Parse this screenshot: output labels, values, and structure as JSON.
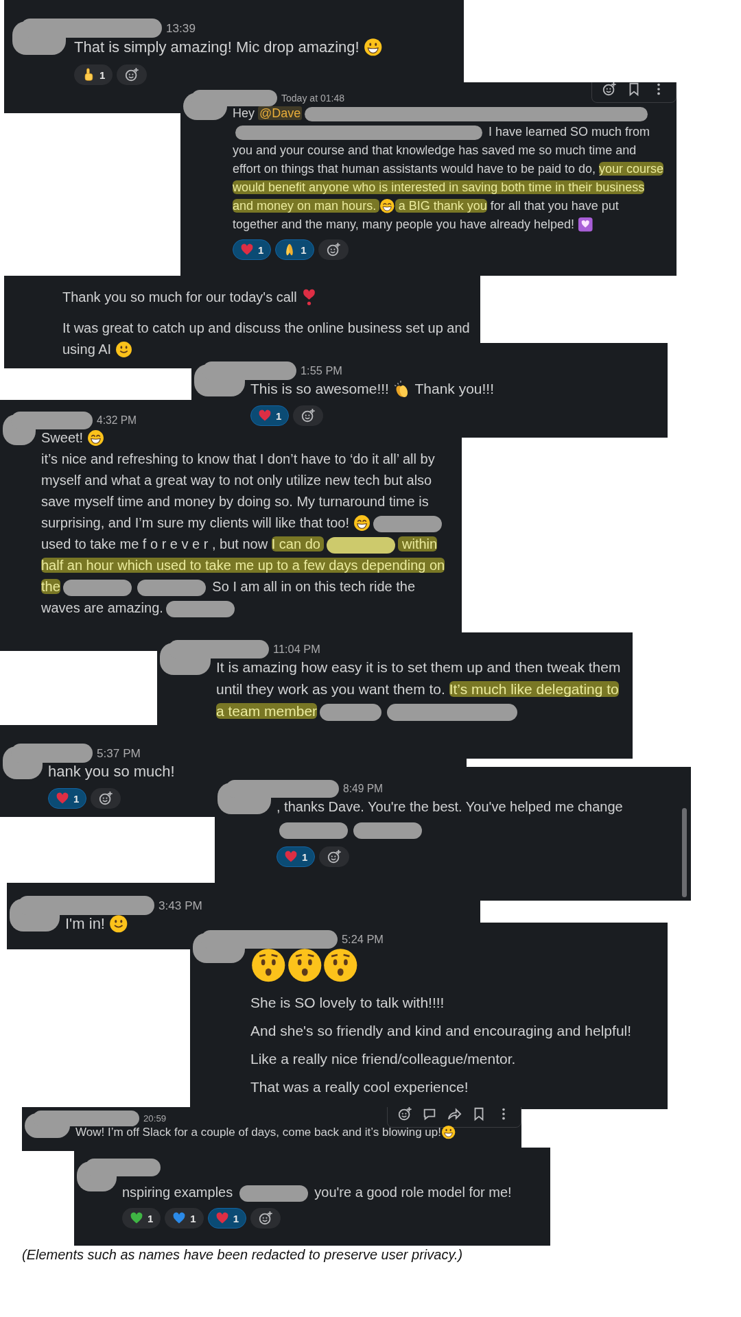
{
  "cards": [
    {
      "sender": {
        "kind": "redacted"
      },
      "time": "13:39",
      "paragraphs": [
        [
          {
            "kind": "text",
            "text": "That is simply amazing! Mic drop amazing! "
          },
          {
            "kind": "grin"
          }
        ]
      ],
      "reactions": [
        {
          "kind": "point-up",
          "count": "1",
          "selected": false
        }
      ]
    },
    {
      "sender": {
        "kind": "redacted"
      },
      "time": "Today at 01:48",
      "toolbar": [
        {
          "kind": "add-reaction"
        },
        {
          "kind": "bookmark"
        },
        {
          "kind": "more"
        }
      ],
      "paragraphs": [
        [
          {
            "kind": "text",
            "text": "Hey "
          },
          {
            "kind": "mention",
            "text": "@Dave"
          },
          {
            "kind": "redacted"
          },
          {
            "kind": "redacted"
          },
          {
            "kind": "text",
            "text": " I have learned SO much from you and your course and that knowledge has saved me so much time and effort on things that human assistants would have to be paid to do, "
          },
          {
            "kind": "highlight",
            "text": "your course would benefit anyone who is interested in saving both time in their business and money on man hours. "
          },
          {
            "kind": "beam"
          },
          {
            "kind": "highlight",
            "text": " a BIG thank you"
          },
          {
            "kind": "text",
            "text": " for all that you have put together and the many, many people you have already helped! "
          },
          {
            "kind": "heart-square"
          }
        ]
      ],
      "reactions": [
        {
          "kind": "heart",
          "color": "#dd2e44",
          "count": "1",
          "selected": true
        },
        {
          "kind": "pray",
          "count": "1",
          "selected": true
        }
      ]
    },
    {
      "paragraphs": [
        [
          {
            "kind": "text",
            "text": "Thank you so much for our today's call "
          },
          {
            "kind": "heart-exclamation"
          }
        ],
        [
          {
            "kind": "text",
            "text": "It was great to catch up and discuss the online business set up and using AI "
          },
          {
            "kind": "smile"
          }
        ]
      ]
    },
    {
      "sender": {
        "kind": "redacted"
      },
      "time": "1:55 PM",
      "paragraphs": [
        [
          {
            "kind": "text",
            "text": "This is so awesome!!! "
          },
          {
            "kind": "clap"
          },
          {
            "kind": "text",
            "text": " Thank you!!!"
          }
        ]
      ],
      "reactions": [
        {
          "kind": "heart",
          "color": "#dd2e44",
          "count": "1",
          "selected": true
        }
      ]
    },
    {
      "sender": {
        "kind": "redacted"
      },
      "time": "4:32 PM",
      "paragraphs": [
        [
          {
            "kind": "text",
            "text": "Sweet! "
          },
          {
            "kind": "beam"
          }
        ],
        [
          {
            "kind": "text",
            "text": "it’s nice and refreshing to know that I don’t have to ‘do it all’ all by myself and what a great way to not only utilize new tech but also save myself time and money by doing so.  My turnaround time is surprising, and I’m sure my clients will like that too! "
          },
          {
            "kind": "beam"
          },
          {
            "kind": "redacted",
            "highlighted": false
          },
          {
            "kind": "text",
            "text": " used to take me f o r e v e r , but now "
          },
          {
            "kind": "highlight",
            "text": "I can do "
          },
          {
            "kind": "redacted",
            "highlighted": true
          },
          {
            "kind": "highlight",
            "text": " within half an hour which used to take me up to a few days depending on the"
          },
          {
            "kind": "redacted",
            "highlighted": false
          },
          {
            "kind": "redacted",
            "highlighted": false
          },
          {
            "kind": "text",
            "text": " So I am all in on this tech ride the waves are amazing."
          },
          {
            "kind": "redacted",
            "highlighted": false
          }
        ]
      ]
    },
    {
      "sender": {
        "kind": "redacted"
      },
      "time": "11:04 PM",
      "paragraphs": [
        [
          {
            "kind": "text",
            "text": "It is amazing how easy it is to set them up and then tweak them until they work as you want them to. "
          },
          {
            "kind": "highlight",
            "text": "It’s much like delegating to a team member"
          },
          {
            "kind": "redacted"
          },
          {
            "kind": "redacted"
          }
        ]
      ]
    },
    {
      "sender": {
        "kind": "redacted"
      },
      "time": "5:37 PM",
      "paragraphs": [
        [
          {
            "kind": "text",
            "text": "hank you so much!"
          }
        ]
      ],
      "reactions": [
        {
          "kind": "heart",
          "color": "#dd2e44",
          "count": "1",
          "selected": true
        }
      ]
    },
    {
      "sender": {
        "kind": "redacted"
      },
      "time": "8:49 PM",
      "scrollbar": {
        "kind": "vertical"
      },
      "paragraphs": [
        [
          {
            "kind": "text",
            "text": ", thanks Dave. You're the best. You've helped me change"
          },
          {
            "kind": "redacted"
          },
          {
            "kind": "redacted"
          }
        ]
      ],
      "reactions": [
        {
          "kind": "heart",
          "color": "#dd2e44",
          "count": "1",
          "selected": true
        }
      ]
    },
    {
      "sender": {
        "kind": "redacted"
      },
      "time": "3:43 PM",
      "paragraphs": [
        [
          {
            "kind": "text",
            "text": "I'm in! "
          },
          {
            "kind": "smile"
          }
        ]
      ]
    },
    {
      "sender": {
        "kind": "redacted"
      },
      "time": "5:24 PM",
      "paragraphs": [
        [
          {
            "kind": "hushed"
          },
          {
            "kind": "hushed"
          },
          {
            "kind": "hushed"
          }
        ],
        [
          {
            "kind": "text",
            "text": "She is SO lovely to talk with!!!!"
          }
        ],
        [
          {
            "kind": "text",
            "text": "And she's so friendly and kind and encouraging and helpful!"
          }
        ],
        [
          {
            "kind": "text",
            "text": "Like a really nice friend/colleague/mentor."
          }
        ],
        [
          {
            "kind": "text",
            "text": "That was a really cool experience!"
          }
        ]
      ]
    },
    {
      "sender": {
        "kind": "redacted"
      },
      "time": "20:59",
      "toolbar": [
        {
          "kind": "add-reaction"
        },
        {
          "kind": "reply"
        },
        {
          "kind": "forward"
        },
        {
          "kind": "bookmark"
        },
        {
          "kind": "more"
        }
      ],
      "paragraphs": [
        [
          {
            "kind": "text",
            "text": "Wow! I’m off Slack for a couple of days, come back and it’s blowing up!"
          },
          {
            "kind": "grin"
          }
        ]
      ]
    },
    {
      "sender": {
        "kind": "redacted"
      },
      "paragraphs": [
        [
          {
            "kind": "text",
            "text": "nspiring examples "
          },
          {
            "kind": "redacted"
          },
          {
            "kind": "text",
            "text": " you're a good role model for me!"
          }
        ]
      ],
      "reactions": [
        {
          "kind": "heart",
          "color": "#3fb544",
          "count": "1",
          "selected": false
        },
        {
          "kind": "heart",
          "color": "#2b8ae8",
          "count": "1",
          "selected": false
        },
        {
          "kind": "heart",
          "color": "#dd2e44",
          "count": "1",
          "selected": true
        }
      ]
    }
  ],
  "caption": "(Elements such as names have been redacted to preserve user privacy.)"
}
